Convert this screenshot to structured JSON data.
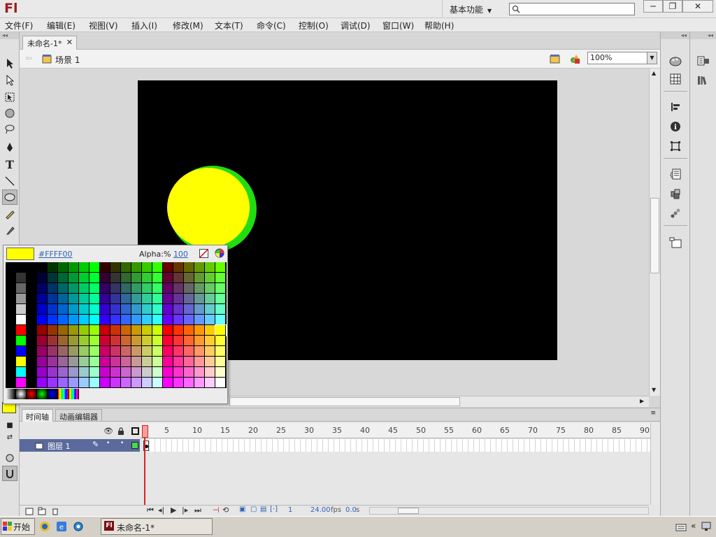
{
  "app": {
    "logo": "Fl",
    "workspace": "基本功能",
    "window_controls": [
      "─",
      "❐",
      "✕"
    ]
  },
  "menu": [
    "文件(F)",
    "编辑(E)",
    "视图(V)",
    "插入(I)",
    "修改(M)",
    "文本(T)",
    "命令(C)",
    "控制(O)",
    "调试(D)",
    "窗口(W)",
    "帮助(H)"
  ],
  "document": {
    "tab_title": "未命名-1*",
    "scene": "场景 1",
    "zoom": "100%"
  },
  "color_picker": {
    "hex": "#FFFF00",
    "alpha_label": "Alpha:%",
    "alpha_value": "100",
    "selected_color": "#FFFF00"
  },
  "stage": {
    "background": "#000000",
    "circle_fill": "#FFFF00",
    "circle_stroke": "#22DD11"
  },
  "timeline": {
    "tabs": [
      "时间轴",
      "动画编辑器"
    ],
    "frame_numbers": [
      "1",
      "5",
      "10",
      "15",
      "20",
      "25",
      "30",
      "35",
      "40",
      "45",
      "50",
      "55",
      "60",
      "65",
      "70",
      "75",
      "80",
      "85",
      "90"
    ],
    "layer_name": "图层 1",
    "current_frame": "1",
    "fps": "24.00",
    "fps_unit": "fps",
    "time": "0.0",
    "time_unit": "s"
  },
  "taskbar": {
    "start": "开始",
    "window": "未命名-1*"
  }
}
